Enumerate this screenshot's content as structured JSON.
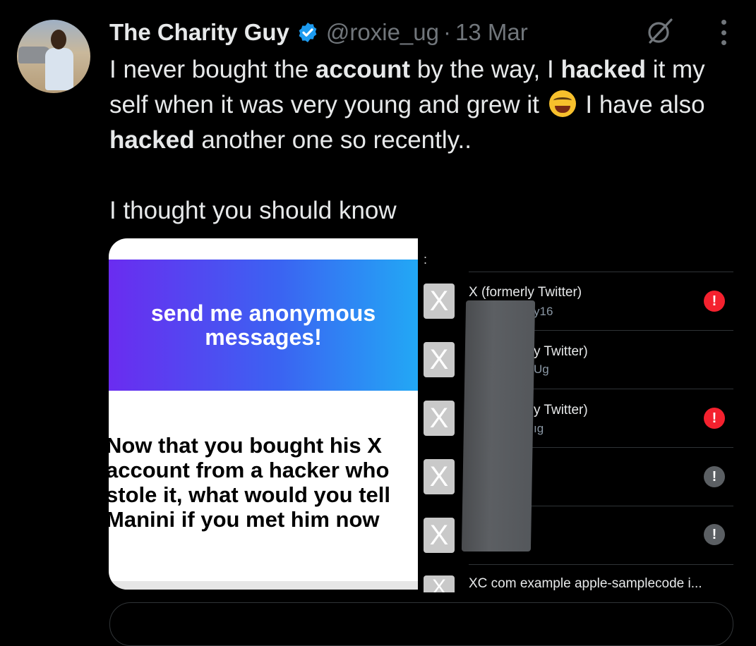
{
  "tweet": {
    "author_name": "The Charity Guy",
    "handle": "@roxie_ug",
    "separator": "·",
    "date": "13 Mar",
    "text": {
      "p1_a": "I never bought the ",
      "p1_b": "account",
      "p1_c": " by the way, I ",
      "p1_d": "hacked",
      "p1_e": " it my self when it was very young and grew it ",
      "p1_f": " I have also ",
      "p1_g": "hacked",
      "p1_h": " another one so recently..",
      "p2": "I thought you should know"
    },
    "icons": {
      "verified": "verified-badge-icon",
      "grok": "grok-icon",
      "more": "more-icon",
      "emoji": "face-with-tears-of-joy-emoji"
    },
    "colors": {
      "verified": "#1d9bf0",
      "alert_red": "#f4212e"
    }
  },
  "card": {
    "banner": "send me anonymous messages!",
    "question_lines": [
      "Now that you bought  his X",
      "account from a hacker who",
      "stole it, what would you tell",
      "Manini if you met him now"
    ]
  },
  "list": {
    "colon": ":",
    "x_glyph": "X",
    "rows": [
      {
        "title": "X (formerly Twitter)",
        "sub": "y16",
        "alert": "!"
      },
      {
        "title": "y Twitter)",
        "sub": "Ug",
        "alert": ""
      },
      {
        "title": "y Twitter)",
        "sub": "ıg",
        "alert": "!"
      },
      {
        "title": "",
        "sub": "",
        "alert": "!"
      },
      {
        "title": "",
        "sub": "",
        "alert": "!"
      }
    ],
    "bottom_row": "XC com example apple-samplecode i..."
  }
}
